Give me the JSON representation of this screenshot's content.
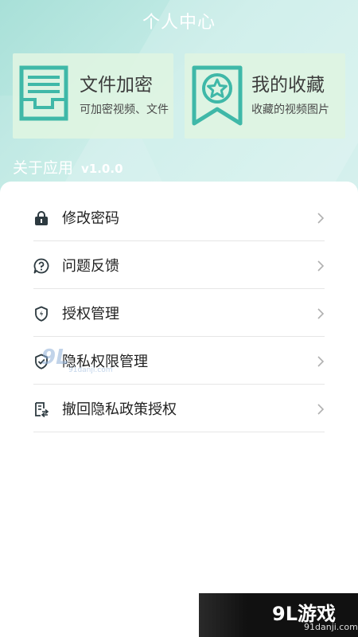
{
  "header": {
    "title": "个人中心"
  },
  "cards": [
    {
      "title": "文件加密",
      "subtitle": "可加密视频、文件",
      "icon": "file-tray-icon"
    },
    {
      "title": "我的收藏",
      "subtitle": "收藏的视频图片",
      "icon": "star-bookmark-icon"
    }
  ],
  "about": {
    "label": "关于应用",
    "version": "v1.0.0"
  },
  "menu": [
    {
      "label": "修改密码",
      "icon": "lock-icon"
    },
    {
      "label": "问题反馈",
      "icon": "question-bubble-icon"
    },
    {
      "label": "授权管理",
      "icon": "shield-icon"
    },
    {
      "label": "隐私权限管理",
      "icon": "shield-check-icon"
    },
    {
      "label": "撤回隐私政策授权",
      "icon": "document-revoke-icon"
    }
  ],
  "watermarks": {
    "center_big": "9L",
    "center_small": "91danji.com",
    "corner_big": "9L游戏",
    "corner_small": "91danji.com"
  },
  "colors": {
    "accent": "#3fb8a8",
    "header_text": "#ffffff",
    "card_bg": "#def4e2",
    "chevron": "#b0b0b0"
  }
}
